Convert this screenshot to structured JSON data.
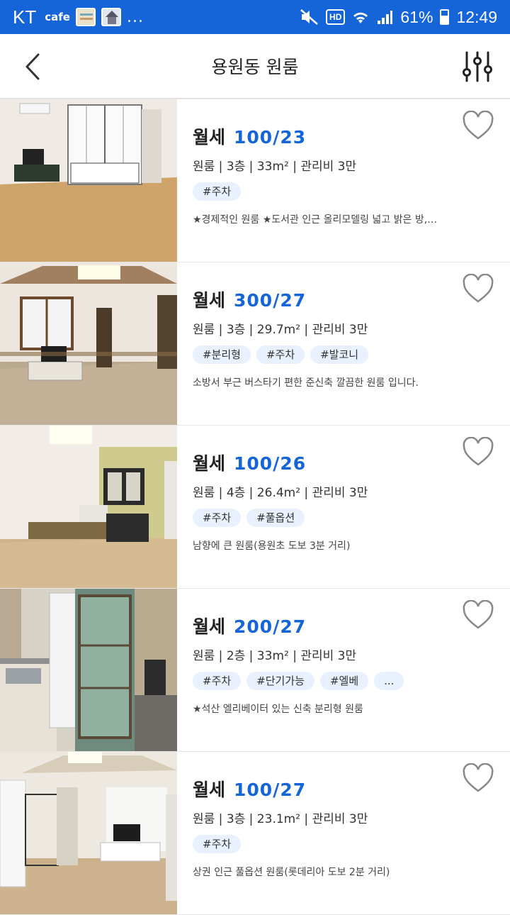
{
  "status_bar": {
    "carrier": "KT",
    "app_label": "cafe",
    "more": "...",
    "hd_label": "HD",
    "battery": "61%",
    "time": "12:49"
  },
  "header": {
    "title": "용원동 원룸"
  },
  "listings": [
    {
      "price_type": "월세",
      "price": "100/23",
      "meta": "원룸 | 3층 | 33m² | 관리비 3만",
      "tags": [
        "#주차"
      ],
      "description": "★경제적인 원룸 ★도서관 인근 올리모델링 넓고 밝은 방,…"
    },
    {
      "price_type": "월세",
      "price": "300/27",
      "meta": "원룸 | 3층 | 29.7m² | 관리비 3만",
      "tags": [
        "#분리형",
        "#주차",
        "#발코니"
      ],
      "description": "소방서 부근 버스타기 편한 준신축 깔끔한 원룸 입니다."
    },
    {
      "price_type": "월세",
      "price": "100/26",
      "meta": "원룸 | 4층 | 26.4m² | 관리비 3만",
      "tags": [
        "#주차",
        "#풀옵션"
      ],
      "description": "남향에 큰 원룸(용원초 도보 3분 거리)"
    },
    {
      "price_type": "월세",
      "price": "200/27",
      "meta": "원룸 | 2층 | 33m² | 관리비 3만",
      "tags": [
        "#주차",
        "#단기가능",
        "#엘베",
        "..."
      ],
      "description": "★석산 엘리베이터 있는 신축 분리형 원룸"
    },
    {
      "price_type": "월세",
      "price": "100/27",
      "meta": "원룸 | 3층 | 23.1m² | 관리비 3만",
      "tags": [
        "#주차"
      ],
      "description": "상권 인근 풀옵션 원룸(롯데리아 도보 2분 거리)"
    }
  ],
  "icons": {
    "back": "chevron-left-icon",
    "filter": "sliders-icon",
    "favorite": "heart-outline-icon"
  },
  "colors": {
    "accent": "#1565d8",
    "tag_bg": "#e8f1fd"
  }
}
